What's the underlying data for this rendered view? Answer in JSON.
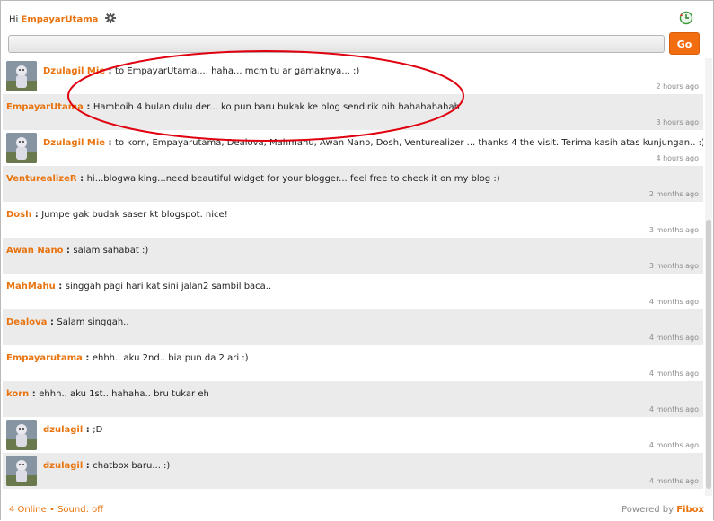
{
  "header": {
    "greeting": "Hi",
    "username": "EmpayarUtama",
    "settings_icon": "gear-icon",
    "history_icon": "history-icon"
  },
  "compose": {
    "value": "",
    "placeholder": "",
    "go_label": "Go"
  },
  "colors": {
    "accent": "#e9740f",
    "button": "#f26d0f",
    "annotation": "#e0000f",
    "row_alt": "#ebebeb"
  },
  "messages": [
    {
      "author": "Dzulagil  Mie",
      "text": "to EmpayarUtama.... haha... mcm tu ar gamaknya... :)",
      "time": "2 hours ago",
      "avatar": true
    },
    {
      "author": "EmpayarUtama",
      "text": "Hamboih 4 bulan dulu der... ko pun baru bukak ke blog sendirik nih hahahahahah",
      "time": "3 hours ago",
      "avatar": false
    },
    {
      "author": "Dzulagil  Mie",
      "text": "to korn, Empayarutama, Dealova, Mahmahu, Awan Nano, Dosh, Venturealizer ... thanks 4 the visit. Terima kasih atas kunjungan.. :)",
      "time": "4 hours ago",
      "avatar": true
    },
    {
      "author": "VenturealizeR",
      "text": "hi...blogwalking...need beautiful widget for your blogger... feel free to check it on my blog :)",
      "time": "2 months ago",
      "avatar": false
    },
    {
      "author": "Dosh",
      "text": "Jumpe gak budak saser kt blogspot. nice!",
      "time": "3 months ago",
      "avatar": false
    },
    {
      "author": "Awan  Nano",
      "text": "salam sahabat :)",
      "time": "3 months ago",
      "avatar": false
    },
    {
      "author": "MahMahu",
      "text": "singgah pagi hari kat sini jalan2 sambil baca..",
      "time": "4 months ago",
      "avatar": false
    },
    {
      "author": "Dealova",
      "text": "Salam singgah..",
      "time": "4 months ago",
      "avatar": false
    },
    {
      "author": "Empayarutama",
      "text": "ehhh.. aku 2nd.. bia pun da 2 ari :)",
      "time": "4 months ago",
      "avatar": false
    },
    {
      "author": "korn",
      "text": "ehhh.. aku 1st.. hahaha.. bru tukar eh",
      "time": "4 months ago",
      "avatar": false
    },
    {
      "author": "dzulagil",
      "text": ";D",
      "time": "4 months ago",
      "avatar": true
    },
    {
      "author": "dzulagil",
      "text": "chatbox baru... :)",
      "time": "4 months ago",
      "avatar": true
    }
  ],
  "footer": {
    "online": "4 Online",
    "sound": "Sound: off",
    "powered_prefix": "Powered by",
    "powered_brand": "Fibox"
  }
}
